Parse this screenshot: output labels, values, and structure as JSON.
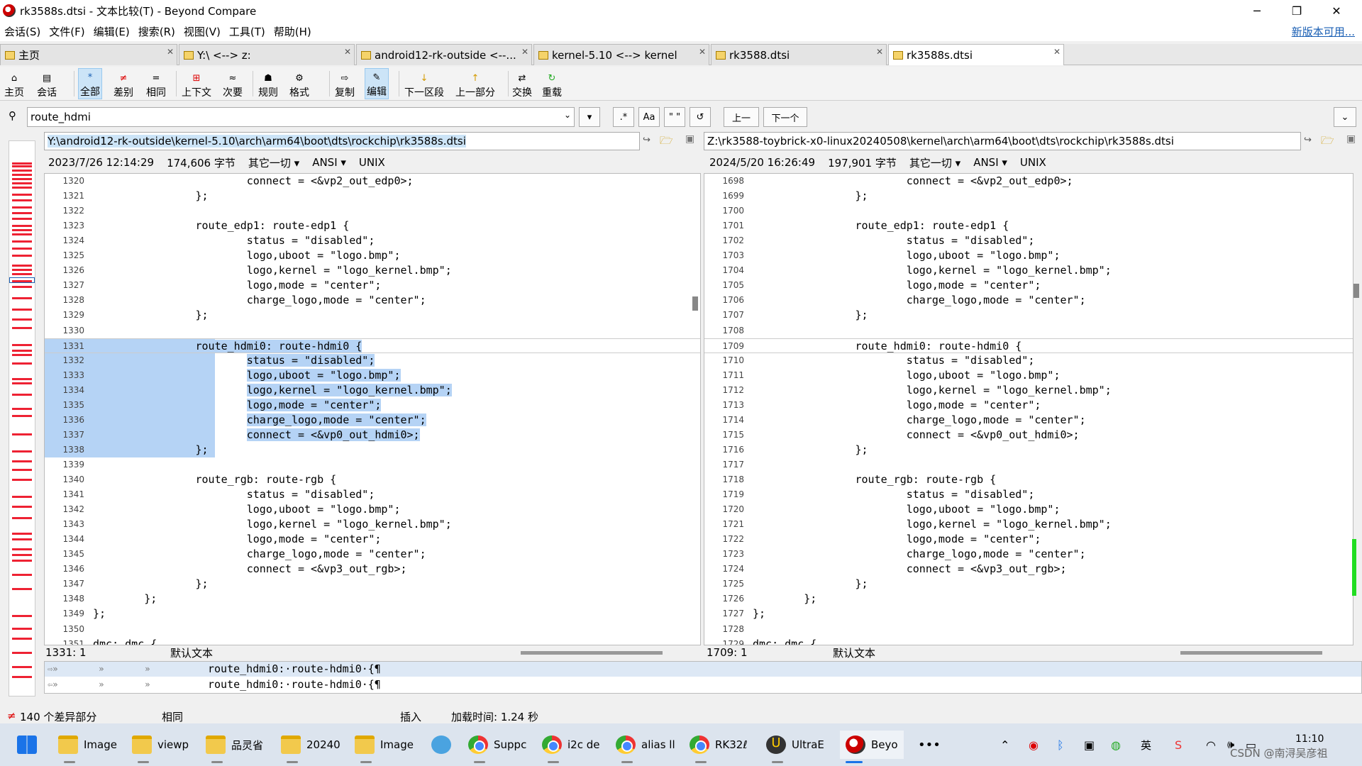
{
  "window": {
    "title": "rk3588s.dtsi - 文本比较(T) - Beyond Compare",
    "minimize": "─",
    "restore": "❐",
    "close": "✕"
  },
  "menu": {
    "items": [
      "会话(S)",
      "文件(F)",
      "编辑(E)",
      "搜索(R)",
      "视图(V)",
      "工具(T)",
      "帮助(H)"
    ],
    "update": "新版本可用..."
  },
  "tabs": [
    "主页",
    "Y:\\ <--> z:",
    "android12-rk-outside <--...",
    "kernel-5.10 <--> kernel",
    "rk3588.dtsi",
    "rk3588s.dtsi"
  ],
  "toolbar": [
    "主页",
    "会话",
    "全部",
    "差别",
    "相同",
    "上下文",
    "次要",
    "规则",
    "格式",
    "复制",
    "编辑",
    "下一区段",
    "上一部分",
    "交换",
    "重载"
  ],
  "find": {
    "value": "route_hdmi",
    "regex": ".*",
    "case": "Aa",
    "word": "\" \"",
    "refresh": "↺",
    "prev": "上一",
    "next": "下一个"
  },
  "left": {
    "path": "Y:\\android12-rk-outside\\kernel-5.10\\arch\\arm64\\boot\\dts\\rockchip\\rk3588s.dtsi",
    "date": "2023/7/26 12:14:29",
    "size": "174,606 字节",
    "other": "其它一切 ▾",
    "enc": "ANSI ▾",
    "eol": "UNIX",
    "cursor": "1331: 1",
    "syntax": "默认文本"
  },
  "right": {
    "path": "Z:\\rk3588-toybrick-x0-linux20240508\\kernel\\arch\\arm64\\boot\\dts\\rockchip\\rk3588s.dtsi",
    "date": "2024/5/20 16:26:49",
    "size": "197,901 字节",
    "other": "其它一切 ▾",
    "enc": "ANSI ▾",
    "eol": "UNIX",
    "cursor": "1709: 1",
    "syntax": "默认文本"
  },
  "lines": [
    "\t\t\tconnect = <&vp2_out_edp0>;",
    "\t\t};",
    "",
    "\t\troute_edp1: route-edp1 {",
    "\t\t\tstatus = \"disabled\";",
    "\t\t\tlogo,uboot = \"logo.bmp\";",
    "\t\t\tlogo,kernel = \"logo_kernel.bmp\";",
    "\t\t\tlogo,mode = \"center\";",
    "\t\t\tcharge_logo,mode = \"center\";",
    "\t\t};",
    "",
    "\t\troute_hdmi0: route-hdmi0 {",
    "\t\t\tstatus = \"disabled\";",
    "\t\t\tlogo,uboot = \"logo.bmp\";",
    "\t\t\tlogo,kernel = \"logo_kernel.bmp\";",
    "\t\t\tlogo,mode = \"center\";",
    "\t\t\tcharge_logo,mode = \"center\";",
    "\t\t\tconnect = <&vp0_out_hdmi0>;",
    "\t\t};",
    "",
    "\t\troute_rgb: route-rgb {",
    "\t\t\tstatus = \"disabled\";",
    "\t\t\tlogo,uboot = \"logo.bmp\";",
    "\t\t\tlogo,kernel = \"logo_kernel.bmp\";",
    "\t\t\tlogo,mode = \"center\";",
    "\t\t\tcharge_logo,mode = \"center\";",
    "\t\t\tconnect = <&vp3_out_rgb>;",
    "\t\t};",
    "\t};",
    "};",
    "",
    "dmc: dmc {"
  ],
  "left_start": 1320,
  "right_start": 1698,
  "detail": {
    "line1": "route_hdmi0:·route-hdmi0·{¶",
    "line2": "route_hdmi0:·route-hdmi0·{¶"
  },
  "statusbar": {
    "diffs": "140 个差异部分",
    "same": "相同",
    "insert": "插入",
    "load": "加载时间: 1.24 秒"
  },
  "taskbar": [
    "Image",
    "viewp",
    "品灵省",
    "20240",
    "Image",
    "",
    "Suppc",
    "i2c de",
    "alias ll",
    "RK32ℓ",
    "UltraE",
    "Beyo",
    "•••"
  ],
  "tray": {
    "lang": "英",
    "time": "11:10",
    "watermark": "CSDN @南浔吴彦祖"
  }
}
